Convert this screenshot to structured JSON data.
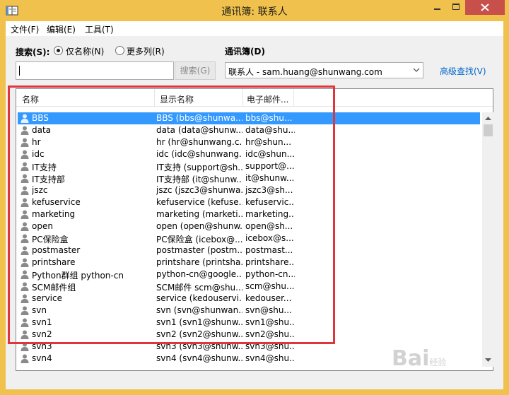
{
  "window": {
    "title": "通讯簿: 联系人",
    "accent": "#f0c14c",
    "close_color": "#c7504b"
  },
  "menu": [
    "文件(F)",
    "编辑(E)",
    "工具(T)"
  ],
  "search": {
    "label": "搜索(S):",
    "option_name": "仅名称(N)",
    "option_more": "更多列(R)",
    "selected": "仅名称(N)",
    "input_value": "",
    "button": "搜索(G)"
  },
  "addressbook": {
    "label": "通讯簿(D)",
    "selected": "联系人 - sam.huang@shunwang.com",
    "advanced_link": "高级查找(V)"
  },
  "table": {
    "columns": [
      "名称",
      "显示名称",
      "电子邮件..."
    ],
    "selected_color": "#3399ff",
    "rows": [
      {
        "name": "BBS",
        "display": "BBS (bbs@shunwa...",
        "email": "bbs@shu..."
      },
      {
        "name": "data",
        "display": "data (data@shunw...",
        "email": "data@shu..."
      },
      {
        "name": "hr",
        "display": "hr (hr@shunwang.c...",
        "email": "hr@shun..."
      },
      {
        "name": "idc",
        "display": "idc (idc@shunwang...",
        "email": "idc@shun..."
      },
      {
        "name": "IT支持",
        "display": "IT支持 (support@sh...",
        "email": "support@..."
      },
      {
        "name": "IT支持部",
        "display": "IT支持部 (it@shunw...",
        "email": "it@shunw..."
      },
      {
        "name": "jszc",
        "display": "jszc (jszc3@shunwa...",
        "email": "jszc3@sh..."
      },
      {
        "name": "kefuservice",
        "display": "kefuservice (kefuse...",
        "email": "kefuservic..."
      },
      {
        "name": "marketing",
        "display": "marketing (marketi...",
        "email": "marketing..."
      },
      {
        "name": "open",
        "display": "open (open@shunw...",
        "email": "open@sh..."
      },
      {
        "name": "PC保险盒",
        "display": "PC保险盒 (icebox@...",
        "email": "icebox@s..."
      },
      {
        "name": "postmaster",
        "display": "postmaster (postm...",
        "email": "postmast..."
      },
      {
        "name": "printshare",
        "display": "printshare (printsha...",
        "email": "printshare..."
      },
      {
        "name": "Python群组 python-cn",
        "display": "python-cn@google...",
        "email": "python-cn..."
      },
      {
        "name": "SCM邮件组",
        "display": "SCM邮件 scm@shu...",
        "email": "scm@shu..."
      },
      {
        "name": "service",
        "display": "service (kedouservi...",
        "email": "kedouser..."
      },
      {
        "name": "svn",
        "display": "svn (svn@shunwan...",
        "email": "svn@shu..."
      },
      {
        "name": "svn1",
        "display": "svn1 (svn1@shunw...",
        "email": "svn1@shu..."
      },
      {
        "name": "svn2",
        "display": "svn2 (svn2@shunw...",
        "email": "svn2@shu..."
      },
      {
        "name": "svn3",
        "display": "svn3 (svn3@shunw...",
        "email": "svn3@shu..."
      },
      {
        "name": "svn4",
        "display": "svn4 (svn4@shunw...",
        "email": "svn4@shu..."
      }
    ]
  },
  "icons": {
    "app": "address-book-icon",
    "contact": "person-icon"
  },
  "watermark": {
    "text": "Bai",
    "sub": "经验"
  }
}
